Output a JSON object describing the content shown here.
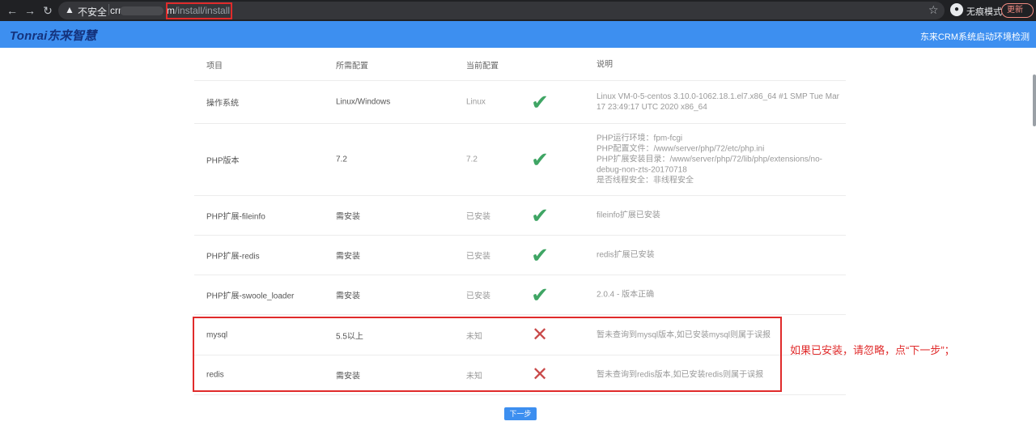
{
  "browser": {
    "back_icon": "arrow-left-icon",
    "forward_icon": "arrow-right-icon",
    "reload_icon": "reload-icon",
    "security_label": "不安全",
    "url_host": "crr",
    "url_path_mid": "m",
    "url_path": "/install/install",
    "star_icon": "star-icon",
    "profile_label": "无痕模式",
    "update_label": "更新"
  },
  "header": {
    "logo": "Tonrai东来智慧",
    "title": "东来CRM系统启动环境检测"
  },
  "table": {
    "headers": [
      "项目",
      "所需配置",
      "当前配置",
      "说明"
    ],
    "rows": [
      {
        "item": "操作系统",
        "required": "Linux/Windows",
        "current": "Linux",
        "status": "ok",
        "desc": "Linux VM-0-5-centos 3.10.0-1062.18.1.el7.x86_64 #1 SMP Tue Mar 17 23:49:17 UTC 2020 x86_64"
      },
      {
        "item": "PHP版本",
        "required": "7.2",
        "current": "7.2",
        "status": "ok",
        "desc": "PHP运行环境：fpm-fcgi\nPHP配置文件：/www/server/php/72/etc/php.ini\nPHP扩展安装目录：/www/server/php/72/lib/php/extensions/no-debug-non-zts-20170718\n是否线程安全：非线程安全"
      },
      {
        "item": "PHP扩展-fileinfo",
        "required": "需安装",
        "current": "已安装",
        "status": "ok",
        "desc": "fileinfo扩展已安装"
      },
      {
        "item": "PHP扩展-redis",
        "required": "需安装",
        "current": "已安装",
        "status": "ok",
        "desc": "redis扩展已安装"
      },
      {
        "item": "PHP扩展-swoole_loader",
        "required": "需安装",
        "current": "已安装",
        "status": "ok",
        "desc": "2.0.4 - 版本正确"
      },
      {
        "item": "mysql",
        "required": "5.5以上",
        "current": "未知",
        "status": "fail",
        "desc": "暂未查询到mysql版本,如已安装mysql则属于误报"
      },
      {
        "item": "redis",
        "required": "需安装",
        "current": "未知",
        "status": "fail",
        "desc": "暂未查询到redis版本,如已安装redis则属于误报"
      }
    ]
  },
  "annotation": "如果已安装，请忽略，点“下一步”；",
  "next_button": "下一步",
  "colors": {
    "header_bg": "#3d8ff0",
    "ok": "#3fa564",
    "fail": "#c94a4a",
    "highlight": "#e02b2b"
  }
}
